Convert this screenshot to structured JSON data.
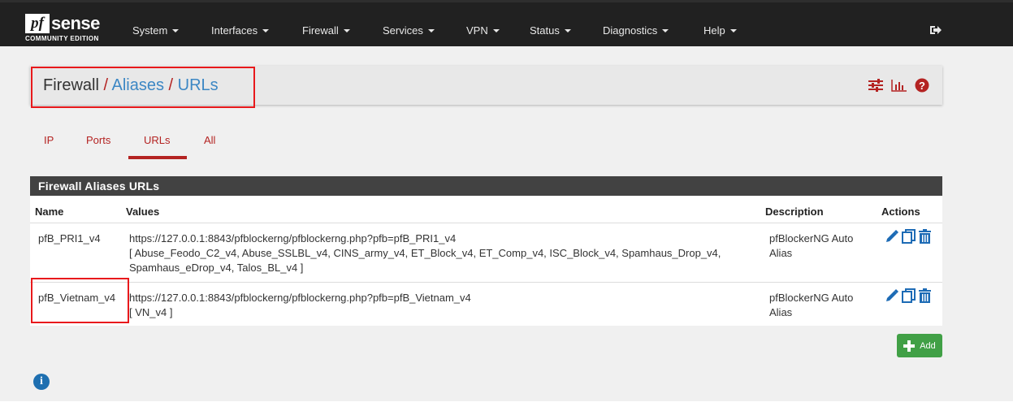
{
  "brand": {
    "logo_mark": "pf",
    "logo_word": "sense",
    "edition": "COMMUNITY EDITION"
  },
  "nav": {
    "items": [
      {
        "label": "System"
      },
      {
        "label": "Interfaces"
      },
      {
        "label": "Firewall"
      },
      {
        "label": "Services"
      },
      {
        "label": "VPN"
      },
      {
        "label": "Status"
      },
      {
        "label": "Diagnostics"
      },
      {
        "label": "Help"
      }
    ],
    "logout_icon": "sign-out-icon"
  },
  "breadcrumb": {
    "root": "Firewall",
    "sep1": "/",
    "level2": "Aliases",
    "sep2": "/",
    "level3": "URLs",
    "icons": [
      "sliders-icon",
      "bar-chart-icon",
      "help-icon"
    ]
  },
  "tabs": [
    {
      "label": "IP",
      "active": false
    },
    {
      "label": "Ports",
      "active": false
    },
    {
      "label": "URLs",
      "active": true
    },
    {
      "label": "All",
      "active": false
    }
  ],
  "panel": {
    "title": "Firewall Aliases URLs",
    "columns": {
      "name": "Name",
      "values": "Values",
      "description": "Description",
      "actions": "Actions"
    },
    "rows": [
      {
        "name": "pfB_PRI1_v4",
        "values_line1": "https://127.0.0.1:8843/pfblockerng/pfblockerng.php?pfb=pfB_PRI1_v4",
        "values_line2": "[ Abuse_Feodo_C2_v4, Abuse_SSLBL_v4, CINS_army_v4, ET_Block_v4, ET_Comp_v4, ISC_Block_v4, Spamhaus_Drop_v4,",
        "values_line3": "Spamhaus_eDrop_v4, Talos_BL_v4 ]",
        "desc_line1": "pfBlockerNG Auto",
        "desc_line2": "Alias"
      },
      {
        "name": "pfB_Vietnam_v4",
        "values_line1": "https://127.0.0.1:8843/pfblockerng/pfblockerng.php?pfb=pfB_Vietnam_v4",
        "values_line2": "[ VN_v4 ]",
        "desc_line1": "pfBlockerNG Auto",
        "desc_line2": "Alias"
      }
    ],
    "row_action_icons": [
      "pencil-icon",
      "copy-icon",
      "trash-icon"
    ]
  },
  "add_button": {
    "label": "Add"
  },
  "info_icon": "info-icon",
  "colors": {
    "navbar": "#212121",
    "accent_red": "#b42322",
    "link_blue": "#3c87c4",
    "panel_head": "#424242",
    "add_green": "#41a046",
    "annotation_red": "#e8191c"
  }
}
